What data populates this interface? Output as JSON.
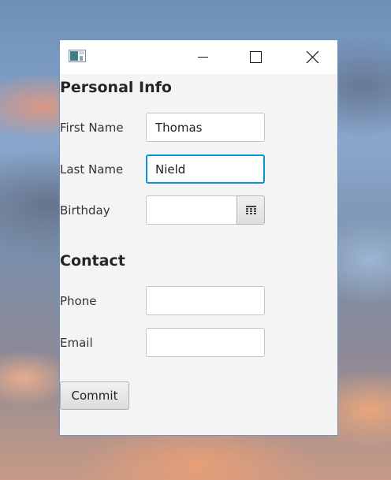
{
  "window": {
    "icon": "app-icon",
    "controls": {
      "minimize_icon": "minimize-icon",
      "maximize_icon": "maximize-icon",
      "close_icon": "close-icon"
    }
  },
  "personal_info": {
    "heading": "Personal Info",
    "first_name": {
      "label": "First Name",
      "value": "Thomas"
    },
    "last_name": {
      "label": "Last Name",
      "value": "Nield"
    },
    "birthday": {
      "label": "Birthday",
      "value": "",
      "picker_icon": "calendar-icon"
    }
  },
  "contact": {
    "heading": "Contact",
    "phone": {
      "label": "Phone",
      "value": ""
    },
    "email": {
      "label": "Email",
      "value": ""
    }
  },
  "actions": {
    "commit_label": "Commit"
  },
  "colors": {
    "focus_border": "#0b93d6",
    "window_background": "#f4f4f4"
  }
}
